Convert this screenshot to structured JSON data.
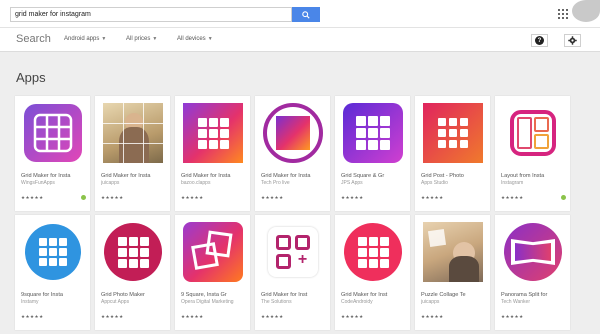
{
  "search": {
    "query": "grid maker for instagram"
  },
  "header": {
    "title": "Search",
    "filters": [
      "Android apps",
      "All prices",
      "All devices"
    ],
    "help_label": "?"
  },
  "section": {
    "title": "Apps"
  },
  "apps": [
    {
      "name": "Grid Maker for Insta",
      "developer": "WingsFunApps",
      "rating": "★★★★★",
      "colors": [
        "#7b4fd6",
        "#e246b7"
      ]
    },
    {
      "name": "Grid Maker for Insta",
      "developer": "juicapps",
      "rating": "★★★★★",
      "colors": [
        "#d8c08f",
        "#9c8a6a"
      ]
    },
    {
      "name": "Grid Maker for Insta",
      "developer": "bazoo.clapps",
      "rating": "★★★★★",
      "colors": [
        "#8e3bd8",
        "#ff8a1f"
      ]
    },
    {
      "name": "Grid Maker for Insta",
      "developer": "Tech Pro live",
      "rating": "★★★★★",
      "colors": [
        "#a12aa0",
        "#ff8a1f"
      ]
    },
    {
      "name": "Grid Square & Gr",
      "developer": "JPS Apps",
      "rating": "★★★★★",
      "colors": [
        "#5a2bd6",
        "#d13fd0"
      ]
    },
    {
      "name": "Grid Post - Photo",
      "developer": "Apps Studio",
      "rating": "★★★★★",
      "colors": [
        "#e0245e",
        "#f07a2c"
      ]
    },
    {
      "name": "Layout from Insta",
      "developer": "Instagram",
      "rating": "★★★★★",
      "colors": [
        "#d6247f",
        "#f0a23a"
      ]
    },
    {
      "name": "9square for Insta",
      "developer": "Instamy",
      "rating": "★★★★★",
      "colors": [
        "#2f94e0",
        "#2a80c9"
      ]
    },
    {
      "name": "Grid Photo Maker",
      "developer": "Appcut Apps",
      "rating": "★★★★★",
      "colors": [
        "#c21e56",
        "#e53065"
      ]
    },
    {
      "name": "9 Square, Insta Gr",
      "developer": "Opera Digital Marketing",
      "rating": "★★★★★",
      "colors": [
        "#9b3bcf",
        "#ff7a1f"
      ]
    },
    {
      "name": "Grid Maker for Inst",
      "developer": "The Solutions",
      "rating": "★★★★★",
      "colors": [
        "#b3246c",
        "#b3246c"
      ]
    },
    {
      "name": "Grid Maker for Inst",
      "developer": "CodeAndroidy",
      "rating": "★★★★★",
      "colors": [
        "#ef2f5c",
        "#ef2f5c"
      ]
    },
    {
      "name": "Puzzle Collage Te",
      "developer": "juicapps",
      "rating": "★★★★★",
      "colors": [
        "#c9a77e",
        "#7e6a58"
      ]
    },
    {
      "name": "Panorama Split for",
      "developer": "Tech Wanker",
      "rating": "★★★★★",
      "colors": [
        "#8a2fc7",
        "#e0406d"
      ]
    }
  ]
}
